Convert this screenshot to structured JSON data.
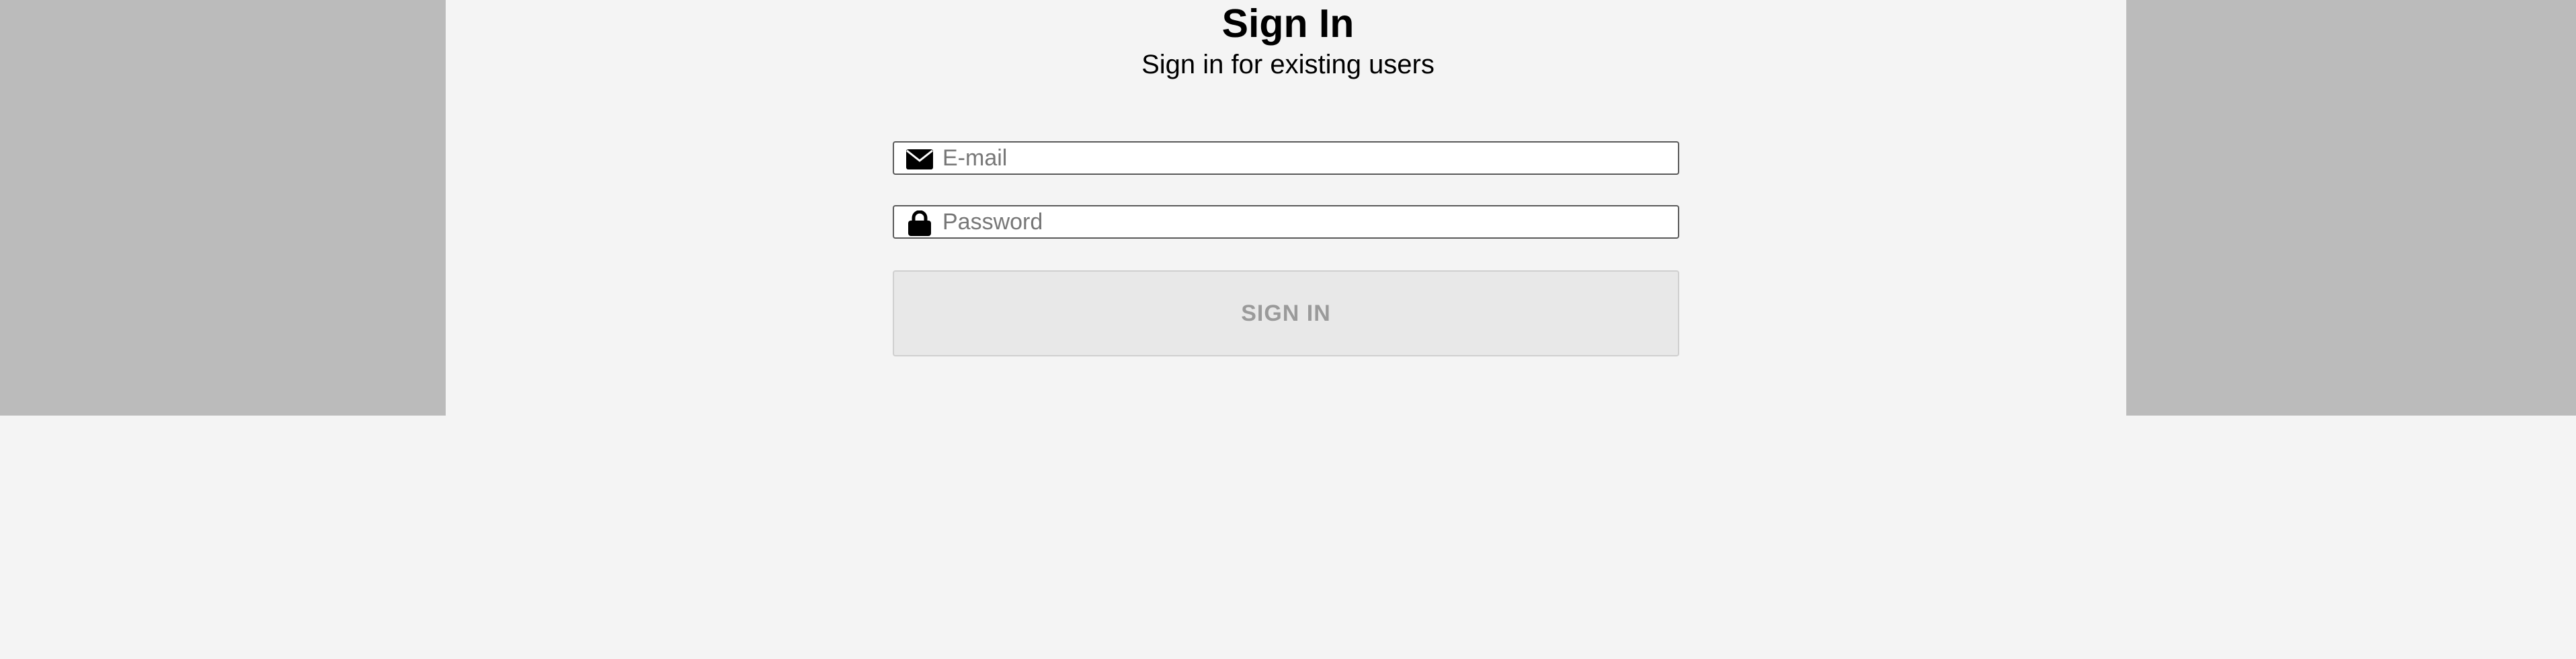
{
  "header": {
    "title": "Sign In",
    "subtitle": "Sign in for existing users"
  },
  "form": {
    "email": {
      "placeholder": "E-mail",
      "value": "",
      "icon": "envelope-icon"
    },
    "password": {
      "placeholder": "Password",
      "value": "",
      "icon": "lock-icon"
    },
    "submit_label": "SIGN IN",
    "submit_disabled": true
  },
  "colors": {
    "side_panel": "#bbbbbb",
    "background": "#f4f4f4",
    "button_bg": "#e8e8e8",
    "button_text": "#9a9a9a"
  }
}
